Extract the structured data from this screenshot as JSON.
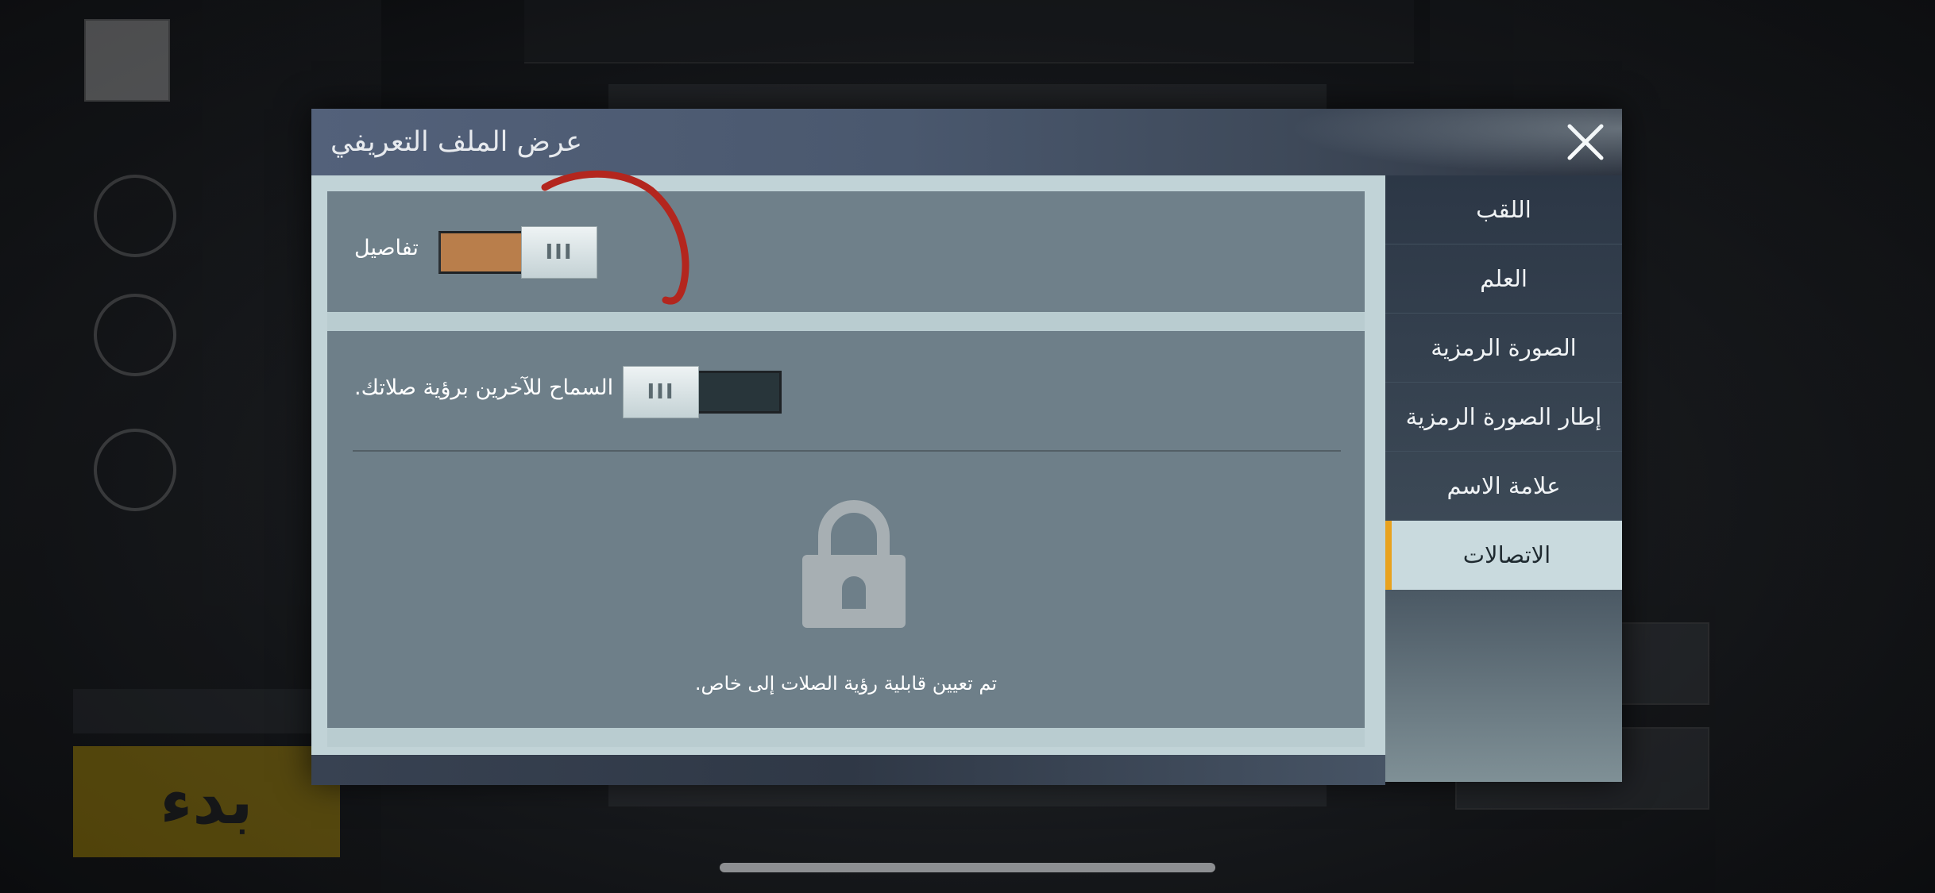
{
  "modal": {
    "title": "عرض الملف التعريفي",
    "close_icon": "close-icon"
  },
  "details": {
    "label": "تفاصيل",
    "toggle_state": "on",
    "knob_glyph": "III"
  },
  "privacy": {
    "label": "السماح للآخرين برؤية صلاتك.",
    "toggle_state": "off",
    "knob_glyph": "III",
    "lock_icon": "lock-icon",
    "note": "تم تعيين قابلية رؤية الصلات إلى خاص."
  },
  "sidebar": {
    "items": [
      {
        "label": "اللقب",
        "active": false
      },
      {
        "label": "العلم",
        "active": false
      },
      {
        "label": "الصورة الرمزية",
        "active": false
      },
      {
        "label": "إطار الصورة الرمزية",
        "active": false
      },
      {
        "label": "علامة الاسم",
        "active": false
      },
      {
        "label": "الاتصالات",
        "active": true
      }
    ]
  },
  "background": {
    "start_button": "بدء"
  },
  "colors": {
    "accent_orange": "#e8a21e",
    "toggle_on": "#b97e4b",
    "toggle_off": "#28353a",
    "annotation_red": "#b3261e"
  }
}
